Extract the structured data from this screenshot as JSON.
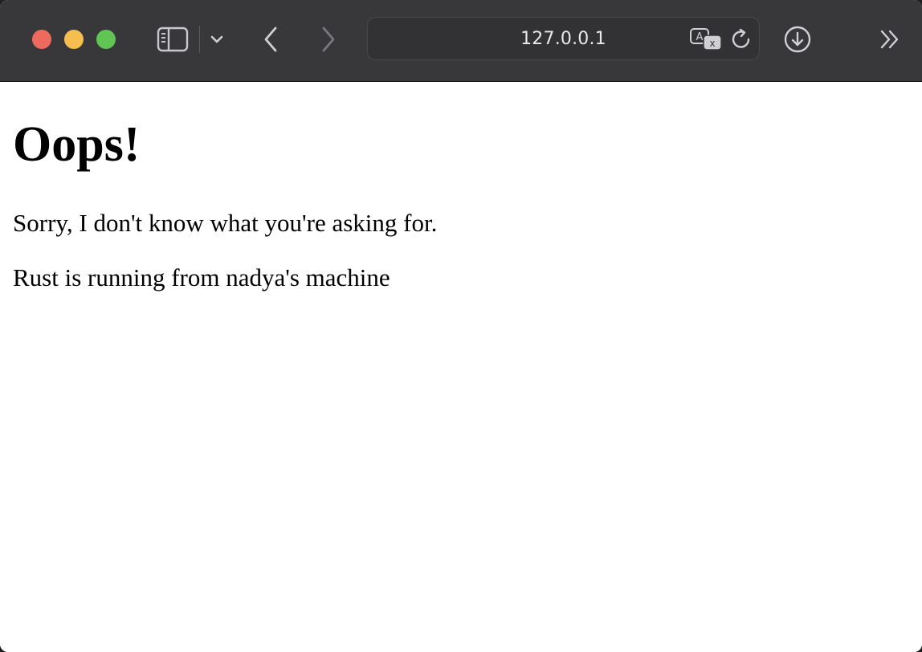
{
  "browser": {
    "address_bar": {
      "text": "127.0.0.1"
    },
    "icons": {
      "sidebar": "sidebar-icon",
      "tab_group_menu": "chevron-down-icon",
      "back": "chevron-left-icon",
      "forward": "chevron-right-icon",
      "translate": "translate-icon",
      "reload": "reload-icon",
      "downloads": "download-icon",
      "overflow": "double-chevron-right-icon"
    },
    "colors": {
      "toolbar_bg": "#38383a",
      "close": "#ed6a5e",
      "minimize": "#f5bf4f",
      "maximize": "#61c554"
    }
  },
  "page": {
    "heading": "Oops!",
    "message": "Sorry, I don't know what you're asking for.",
    "footer_note": "Rust is running from nadya's machine"
  }
}
